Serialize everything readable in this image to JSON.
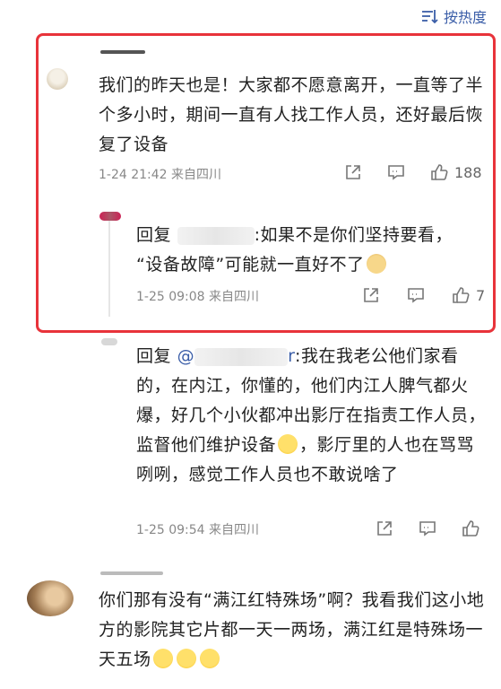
{
  "sort": {
    "label": "按热度",
    "icon": "sort-icon"
  },
  "comments": [
    {
      "text": "我们的昨天也是！大家都不愿意离开，一直等了半个多小时，期间一直有人找工作人员，还好最后恢复了设备",
      "meta": "1-24 21:42  来自四川",
      "likes": "188"
    },
    {
      "reply_prefix": "回复",
      "reply_suffix": ":如果不是你们坚持要看，",
      "line2": "“设备故障”可能就一直好不了",
      "meta": "1-25 09:08  来自四川",
      "likes": "7"
    },
    {
      "reply_prefix": "回复",
      "mention_at": "@",
      "mention_tail": "r",
      "reply_text": ":我在我老公他们家看的，在内江，你懂的，他们内江人脾气都火爆，好几个小伙都冲出影厅在指责工作人员，监督他们维护设备",
      "reply_text_2": "，影厅里的人也在骂骂咧咧，感觉工作人员也不敢说啥了",
      "meta": "1-25 09:54  来自四川"
    },
    {
      "text": "你们那有没有“满江红特殊场”啊？我看我们这小地方的影院其它片都一天一两场，满江红是特殊场一天五场"
    }
  ],
  "colors": {
    "highlight": "#e8333a",
    "link": "#3b5ea8",
    "meta": "#888888"
  }
}
